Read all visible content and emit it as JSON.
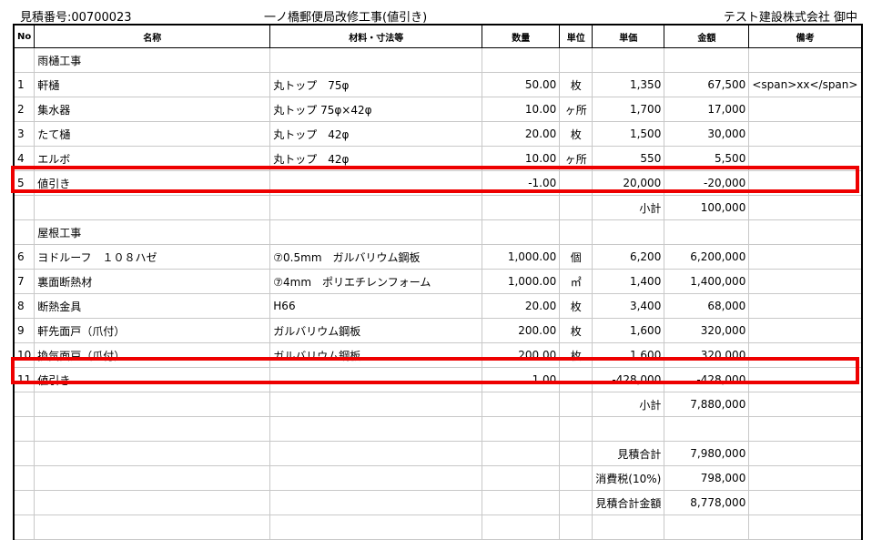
{
  "header": {
    "estimate_number": "見積番号:00700023",
    "title": "一ノ橋郵便局改修工事(値引き)",
    "client": "テスト建設株式会社 御中"
  },
  "columns": [
    "No",
    "名称",
    "材料・寸法等",
    "数量",
    "単位",
    "単価",
    "金額",
    "備考"
  ],
  "sections": {
    "s1": "雨樋工事",
    "s2": "屋根工事"
  },
  "rows": [
    {
      "no": "1",
      "name": "軒樋",
      "spec": "丸トップ　75φ",
      "qty": "50.00",
      "unit": "枚",
      "price": "1,350",
      "amount": "67,500",
      "note": "<span>xx</span>"
    },
    {
      "no": "2",
      "name": "集水器",
      "spec": "丸トップ 75φ×42φ",
      "qty": "10.00",
      "unit": "ヶ所",
      "price": "1,700",
      "amount": "17,000",
      "note": ""
    },
    {
      "no": "3",
      "name": "たて樋",
      "spec": "丸トップ　42φ",
      "qty": "20.00",
      "unit": "枚",
      "price": "1,500",
      "amount": "30,000",
      "note": ""
    },
    {
      "no": "4",
      "name": "エルボ",
      "spec": "丸トップ　42φ",
      "qty": "10.00",
      "unit": "ヶ所",
      "price": "550",
      "amount": "5,500",
      "note": ""
    },
    {
      "no": "5",
      "name": "値引き",
      "spec": "",
      "qty": "-1.00",
      "unit": "",
      "price": "20,000",
      "amount": "-20,000",
      "note": ""
    },
    {
      "no": "6",
      "name": "ヨドルーフ　１０８ハゼ",
      "spec": "⑦0.5mm　ガルバリウム鋼板",
      "qty": "1,000.00",
      "unit": "個",
      "price": "6,200",
      "amount": "6,200,000",
      "note": ""
    },
    {
      "no": "7",
      "name": "裏面断熱材",
      "spec": "⑦4mm　ポリエチレンフォーム",
      "qty": "1,000.00",
      "unit": "㎡",
      "price": "1,400",
      "amount": "1,400,000",
      "note": ""
    },
    {
      "no": "8",
      "name": "断熱金具",
      "spec": "H66",
      "qty": "20.00",
      "unit": "枚",
      "price": "3,400",
      "amount": "68,000",
      "note": ""
    },
    {
      "no": "9",
      "name": "軒先面戸（爪付）",
      "spec": "ガルバリウム鋼板",
      "qty": "200.00",
      "unit": "枚",
      "price": "1,600",
      "amount": "320,000",
      "note": ""
    },
    {
      "no": "10",
      "name": "換気面戸（爪付）",
      "spec": "ガルバリウム鋼板",
      "qty": "200.00",
      "unit": "枚",
      "price": "1,600",
      "amount": "320,000",
      "note": ""
    },
    {
      "no": "11",
      "name": "値引き",
      "spec": "",
      "qty": "1.00",
      "unit": "",
      "price": "-428,000",
      "amount": "-428,000",
      "note": ""
    }
  ],
  "subtotals": {
    "label": "小計",
    "s1": "100,000",
    "s2": "7,880,000"
  },
  "totals": {
    "estimate_total_label": "見積合計",
    "estimate_total": "7,980,000",
    "tax_label": "消費税(10%)",
    "tax": "798,000",
    "grand_total_label": "見積合計金額",
    "grand_total": "8,778,000"
  },
  "colors": {
    "highlight": "#ee0000"
  }
}
